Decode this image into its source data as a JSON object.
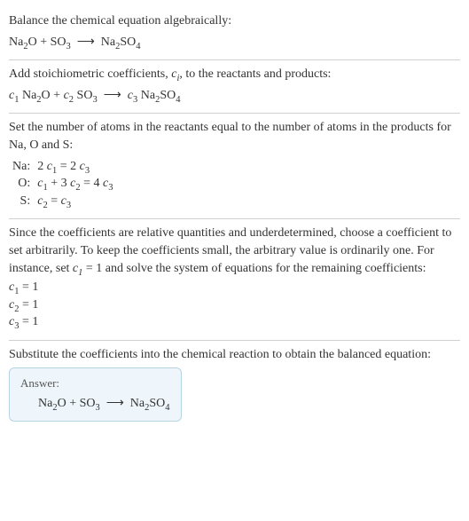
{
  "s1": {
    "title": "Balance the chemical equation algebraically:"
  },
  "s2": {
    "title_a": "Add stoichiometric coefficients, ",
    "title_b": ", to the reactants and products:"
  },
  "s3": {
    "title": "Set the number of atoms in the reactants equal to the number of atoms in the products for Na, O and S:",
    "rows": [
      {
        "el": "Na:",
        "eq_a": "2 ",
        "eq_b": " = 2 "
      },
      {
        "el": "O:",
        "eq_mid": " + 3 ",
        "eq_rhs": " = 4 "
      },
      {
        "el": "S:",
        "eq_mid": " = "
      }
    ]
  },
  "s4": {
    "title_a": "Since the coefficients are relative quantities and underdetermined, choose a coefficient to set arbitrarily. To keep the coefficients small, the arbitrary value is ordinarily one. For instance, set ",
    "title_b": " = 1 and solve the system of equations for the remaining coefficients:",
    "c1": " = 1",
    "c2": " = 1",
    "c3": " = 1"
  },
  "s5": {
    "title": "Substitute the coefficients into the chemical reaction to obtain the balanced equation:",
    "answer_label": "Answer:"
  },
  "c": {
    "c1": "c",
    "c2": "c",
    "c3": "c",
    "ci": "c",
    "one": "1",
    "two": "2",
    "three": "3",
    "i": "i"
  }
}
